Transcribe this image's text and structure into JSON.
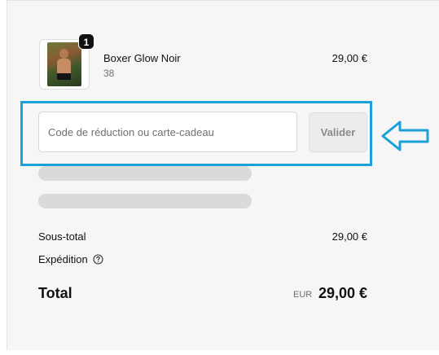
{
  "product": {
    "name": "Boxer Glow Noir",
    "variant": "38",
    "price": "29,00 €",
    "quantity": "1",
    "thumbnail_icon": "product-photo"
  },
  "discount": {
    "placeholder": "Code de réduction ou carte-cadeau",
    "value": "",
    "button_label": "Valider",
    "highlight_color": "#1ba1d8",
    "arrow_icon": "arrow-left-outline-icon"
  },
  "summary": {
    "subtotal_label": "Sous-total",
    "subtotal_value": "29,00 €",
    "shipping_label": "Expédition",
    "shipping_help_icon": "question-circle-icon",
    "total_label": "Total",
    "total_currency": "EUR",
    "total_value": "29,00 €"
  },
  "colors": {
    "panel_background": "#f6f6f6",
    "skeleton": "#dadada",
    "accent_annotation": "#1ba1d8"
  }
}
